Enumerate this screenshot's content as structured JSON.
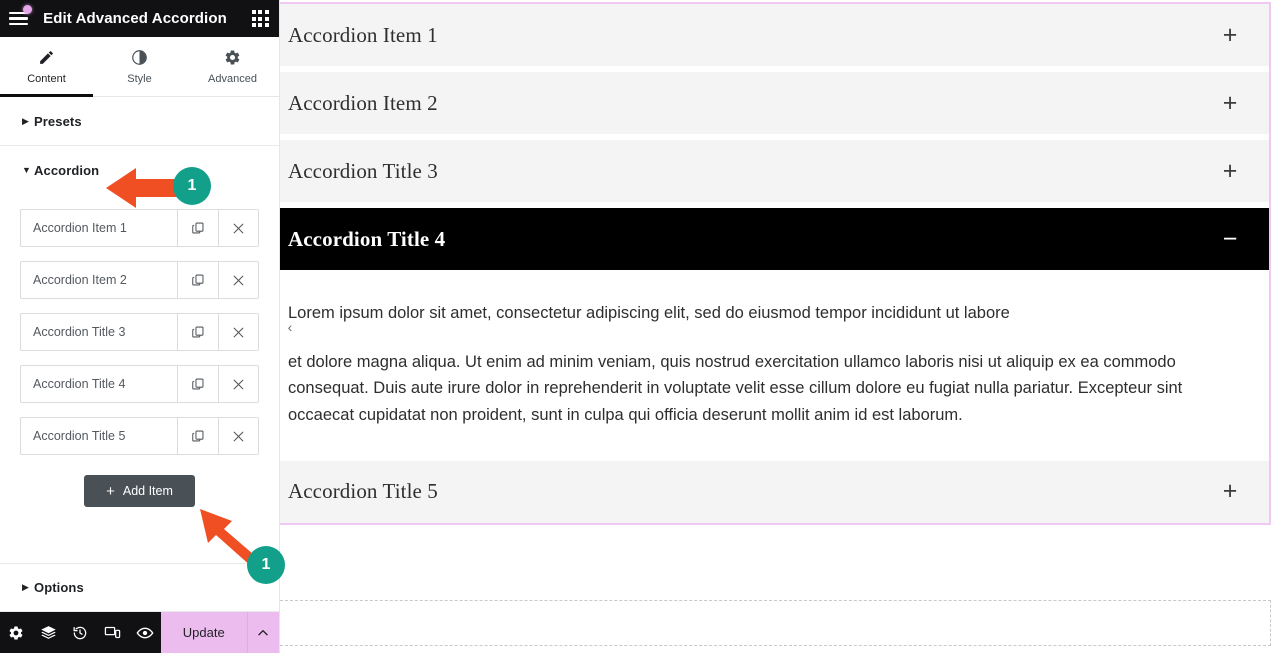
{
  "panel": {
    "title": "Edit Advanced Accordion",
    "menu_icon": "hamburger-menu-icon",
    "apps_icon": "apps-grid-icon",
    "tabs": [
      {
        "label": "Content",
        "icon": "pencil-icon",
        "active": true
      },
      {
        "label": "Style",
        "icon": "contrast-icon",
        "active": false
      },
      {
        "label": "Advanced",
        "icon": "gear-icon",
        "active": false
      }
    ],
    "sections": {
      "presets": {
        "label": "Presets",
        "expanded": false
      },
      "accordion": {
        "label": "Accordion",
        "expanded": true
      },
      "options": {
        "label": "Options",
        "expanded": false
      }
    },
    "repeater": {
      "items": [
        {
          "title": "Accordion Item 1"
        },
        {
          "title": "Accordion Item 2"
        },
        {
          "title": "Accordion Title 3"
        },
        {
          "title": "Accordion Title 4"
        },
        {
          "title": "Accordion Title 5"
        }
      ],
      "duplicate_icon": "copy-icon",
      "remove_icon": "close-icon",
      "add_item_label": "Add Item",
      "add_item_plus": "+"
    }
  },
  "bottom_bar": {
    "icons": [
      {
        "name": "settings-gear-icon"
      },
      {
        "name": "navigator-layers-icon"
      },
      {
        "name": "history-revisions-icon"
      },
      {
        "name": "responsive-mode-icon"
      },
      {
        "name": "preview-eye-icon"
      }
    ],
    "update_label": "Update",
    "update_caret": "chevron-up-icon",
    "update_color": "#edbcee"
  },
  "preview": {
    "collapse_chevron": "‹",
    "accordion": [
      {
        "title": "Accordion Item 1",
        "state": "collapsed",
        "icon": "+"
      },
      {
        "title": "Accordion Item 2",
        "state": "collapsed",
        "icon": "+"
      },
      {
        "title": "Accordion Title 3",
        "state": "collapsed",
        "icon": "+"
      },
      {
        "title": "Accordion Title 4",
        "state": "expanded",
        "icon": "−",
        "body": [
          "Lorem ipsum dolor sit amet, consectetur adipiscing elit, sed do eiusmod tempor incididunt ut labore",
          "et dolore magna aliqua. Ut enim ad minim veniam, quis nostrud exercitation ullamco laboris nisi ut aliquip ex ea commodo consequat. Duis aute irure dolor in reprehenderit in voluptate velit esse cillum dolore eu fugiat nulla pariatur. Excepteur sint occaecat cupidatat non proident, sunt in culpa qui officia deserunt mollit anim id est laborum."
        ]
      },
      {
        "title": "Accordion Title 5",
        "state": "collapsed",
        "icon": "+"
      }
    ],
    "selection_border_color": "#f0c9f2",
    "active_header_bg": "#000000",
    "header_bg": "#f4f4f4"
  },
  "annotations": {
    "arrow_color": "#f04e23",
    "badge_color": "#12a08a",
    "items": [
      {
        "label": "1",
        "target": "accordion-section-header"
      },
      {
        "label": "1",
        "target": "add-item-button"
      }
    ]
  }
}
